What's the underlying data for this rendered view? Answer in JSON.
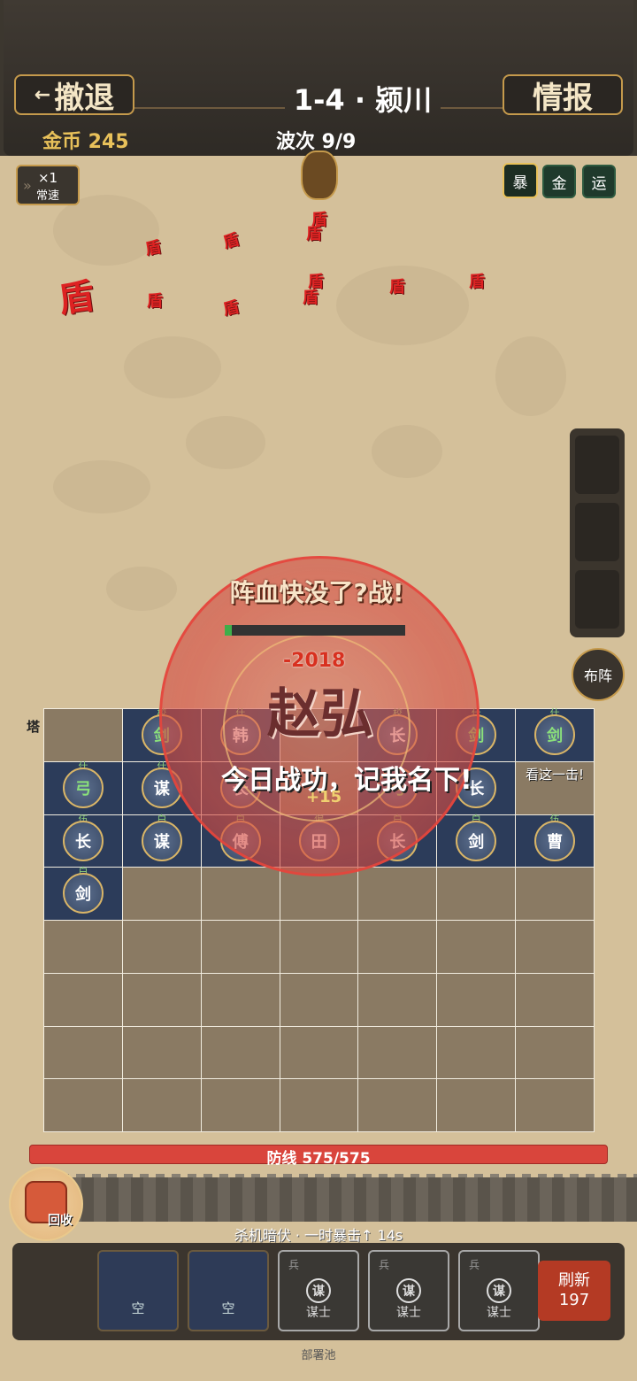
{
  "header": {
    "retreat_label": "撤退",
    "back_arrow": "←",
    "level_title": "1-4 · 颍川",
    "info_label": "情报",
    "coins": "金币 245",
    "wave": "波次 9/9"
  },
  "speed": {
    "multiplier": "×1",
    "mode": "常速",
    "icon": "double-chevron-icon"
  },
  "buffs": [
    "暴",
    "金",
    "运"
  ],
  "enemies": {
    "label": "盾",
    "count": 11,
    "color": "#d22"
  },
  "side_buttons": {
    "formation": "布阵"
  },
  "battle": {
    "shout": "阵血快没了?战!",
    "damage": "-2018",
    "hero_name": "赵弘",
    "quote": "今日战功，记我名下!",
    "bonus": "+15",
    "side_quote": "看这一击!",
    "tower_tag": "塔",
    "boss_hp_fraction": 0.04
  },
  "grid": {
    "rows": [
      [
        {
          "u": "",
          "r": ""
        },
        {
          "u": "剑",
          "r": "校"
        },
        {
          "u": "韩",
          "r": "什"
        },
        {
          "u": "",
          "r": ""
        },
        {
          "u": "长",
          "r": "校"
        },
        {
          "u": "剑",
          "r": "什"
        },
        {
          "u": "剑",
          "r": "什"
        }
      ],
      [
        {
          "u": "弓",
          "r": "什"
        },
        {
          "u": "谋",
          "r": "什"
        },
        {
          "u": "长",
          "r": ""
        },
        {
          "u": "",
          "r": ""
        },
        {
          "u": "弓",
          "r": ""
        },
        {
          "u": "长",
          "r": ""
        },
        {
          "u": "",
          "r": ""
        }
      ],
      [
        {
          "u": "长",
          "r": "伍"
        },
        {
          "u": "谋",
          "r": "白"
        },
        {
          "u": "傅",
          "r": "白"
        },
        {
          "u": "田",
          "r": "偏"
        },
        {
          "u": "长",
          "r": "白"
        },
        {
          "u": "剑",
          "r": "白"
        },
        {
          "u": "曹",
          "r": "伍"
        }
      ],
      [
        {
          "u": "剑",
          "r": "白"
        }
      ]
    ]
  },
  "defense": {
    "label": "防线 575/575",
    "fraction": 1.0
  },
  "recycle_label": "回收",
  "ambush_text": "杀机暗伏 · 一时暴击↑ 14s",
  "pool": {
    "slots": [
      {
        "type": "empty",
        "label": "空"
      },
      {
        "type": "empty",
        "label": "空"
      },
      {
        "type": "unit",
        "tag": "兵",
        "icon": "谋",
        "name": "谋士"
      },
      {
        "type": "unit",
        "tag": "兵",
        "icon": "谋",
        "name": "谋士"
      },
      {
        "type": "unit",
        "tag": "兵",
        "icon": "谋",
        "name": "谋士"
      }
    ],
    "refresh_label": "刷新",
    "refresh_cost": "197",
    "label": "部署池"
  }
}
